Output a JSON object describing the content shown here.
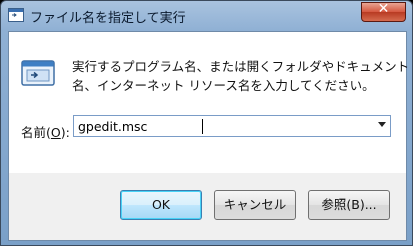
{
  "window": {
    "title": "ファイル名を指定して実行",
    "close_label": "✕"
  },
  "dialog": {
    "description_line1": "実行するプログラム名、または開くフォルダやドキュメント",
    "description_line2": "名、インターネット リソース名を入力してください。",
    "name_label_prefix": "名前(",
    "name_label_access_key": "O",
    "name_label_suffix": "):",
    "command_value": "gpedit.msc"
  },
  "buttons": {
    "ok": "OK",
    "cancel": "キャンセル",
    "browse": "参照(B)..."
  },
  "icons": {
    "title": "run-window-icon",
    "app": "run-program-icon",
    "dropdown": "chevron-down-icon"
  },
  "colors": {
    "title_bar": "#8fb0d4",
    "close_button": "#d5573f",
    "default_button_border": "#3c7fb1"
  }
}
